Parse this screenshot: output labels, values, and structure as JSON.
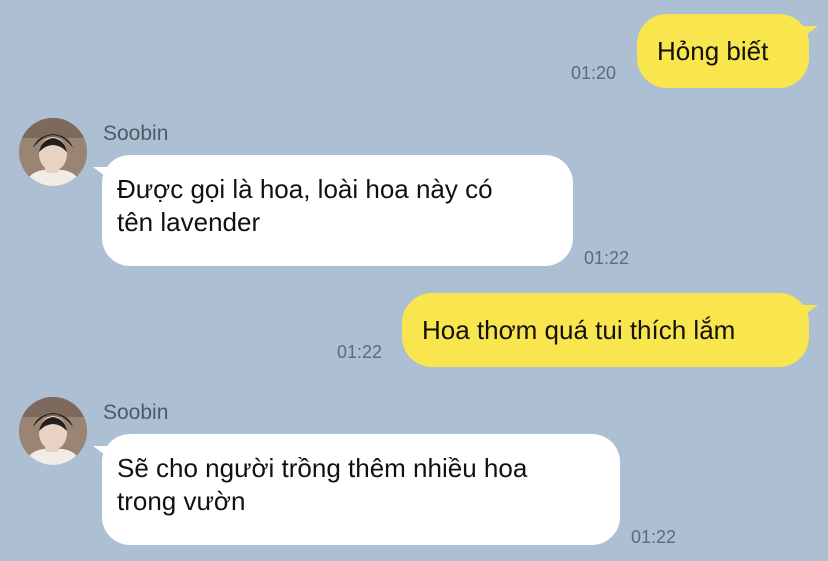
{
  "messages": [
    {
      "sender": "me",
      "text": "Hỏng biết",
      "time": "01:20"
    },
    {
      "sender": "them",
      "name": "Soobin",
      "lines": [
        "Được gọi là hoa, loài hoa này có",
        "tên lavender"
      ],
      "time": "01:22"
    },
    {
      "sender": "me",
      "text": "Hoa thơm quá tui thích lắm",
      "time": "01:22"
    },
    {
      "sender": "them",
      "name": "Soobin",
      "lines": [
        "Sẽ cho người trồng thêm nhiều hoa",
        "trong vườn"
      ],
      "time": "01:22"
    }
  ],
  "colors": {
    "background": "#adbfd2",
    "outgoing_bubble": "#f9e54e",
    "incoming_bubble": "#ffffff",
    "timestamp": "#5d6b79"
  },
  "icons": {
    "avatar": "profile-photo-icon"
  }
}
